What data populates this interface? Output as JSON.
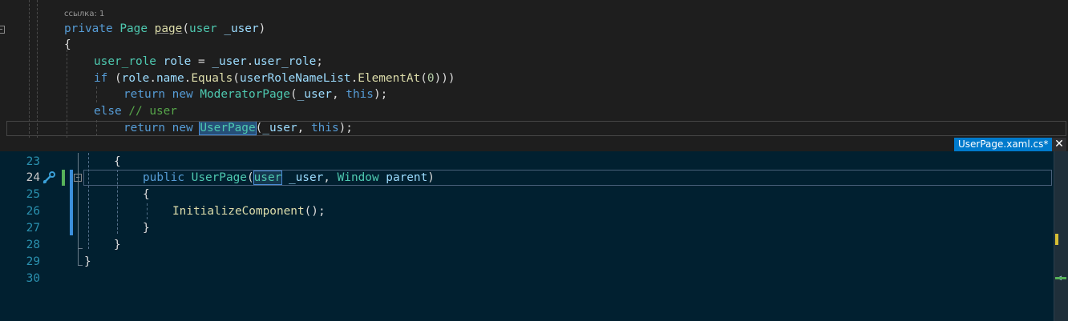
{
  "top_pane": {
    "codelens": "ссылка: 1",
    "lines": [
      "private Page page(user _user)",
      "{",
      "user_role role = _user.user_role;",
      "if (role.name.Equals(userRoleNameList.ElementAt(0)))",
      "return new ModeratorPage(_user, this);",
      "else // user",
      "return new UserPage(_user, this);"
    ]
  },
  "tab": {
    "label": "UserPage.xaml.cs*",
    "pin_icon": "pin-icon",
    "close_icon": "close-icon",
    "close_symbol": "✕"
  },
  "bottom_pane": {
    "line_numbers": [
      "23",
      "24",
      "25",
      "26",
      "27",
      "28",
      "29",
      "30"
    ],
    "current_line": "24",
    "lines": [
      "{",
      "public UserPage(user _user, Window parent)",
      "{",
      "InitializeComponent();",
      "}",
      "}",
      "}",
      ""
    ]
  },
  "colors": {
    "keyword": "#569cd6",
    "type": "#4ec9b0",
    "method": "#dcdcaa",
    "variable": "#9cdcfe",
    "comment": "#57a64a",
    "line_number": "#2b91af",
    "editor_bg_top": "#1e1e1e",
    "editor_bg_bottom": "#012030",
    "tab_accent": "#007acc"
  }
}
